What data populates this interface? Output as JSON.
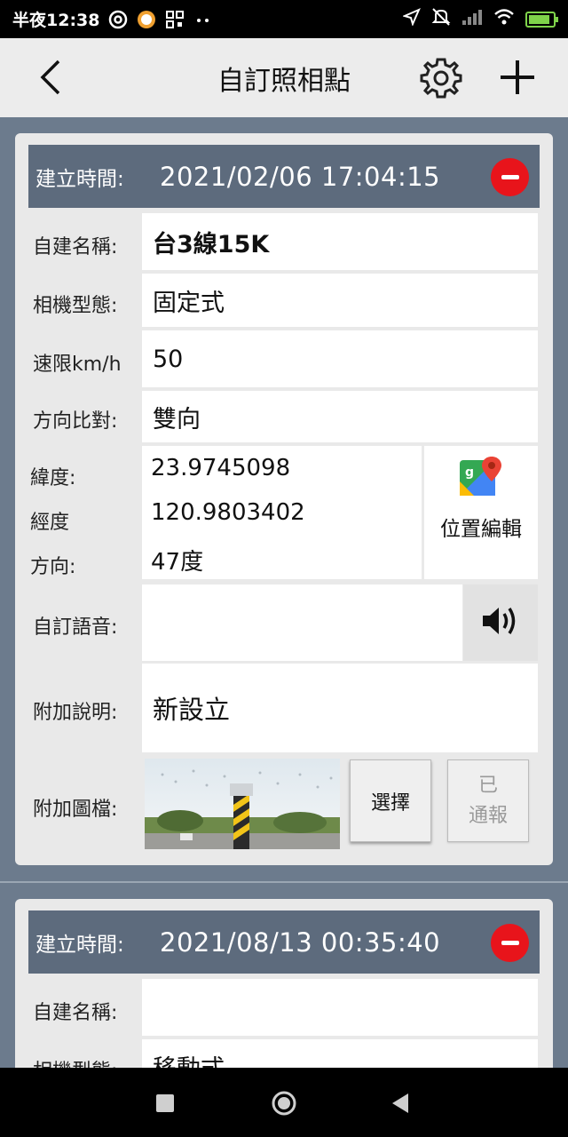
{
  "status_bar": {
    "time": "半夜12:38",
    "battery_level": 0.9
  },
  "header": {
    "title": "自訂照相點",
    "back_icon": "back-arrow-icon",
    "settings_icon": "gear-icon",
    "add_icon": "plus-icon"
  },
  "records": [
    {
      "created_label": "建立時間:",
      "created_value": "2021/02/06 17:04:15",
      "name_label": "自建名稱:",
      "name_value": "台3線15K",
      "camera_label": "相機型態:",
      "camera_value": "固定式",
      "speed_label": "速限km/h",
      "speed_value": "50",
      "direction_match_label": "方向比對:",
      "direction_match_value": "雙向",
      "lat_label": "緯度:",
      "lat_value": "23.9745098",
      "lng_label": "經度",
      "lng_value": "120.9803402",
      "heading_label": "方向:",
      "heading_value": "47度",
      "edit_location_label": "位置編輯",
      "voice_label": "自訂語音:",
      "voice_value": "",
      "note_label": "附加說明:",
      "note_value": "新設立",
      "image_label": "附加圖檔:",
      "select_button": "選擇",
      "reported_line1": "已",
      "reported_line2": "通報"
    },
    {
      "created_label": "建立時間:",
      "created_value": "2021/08/13 00:35:40",
      "name_label": "自建名稱:",
      "name_value": "",
      "camera_label": "相機型態:",
      "camera_value": "移動式"
    }
  ],
  "colors": {
    "header_bar": "#5d6b7d",
    "background": "#6c7b8d",
    "delete": "#e8141b"
  }
}
